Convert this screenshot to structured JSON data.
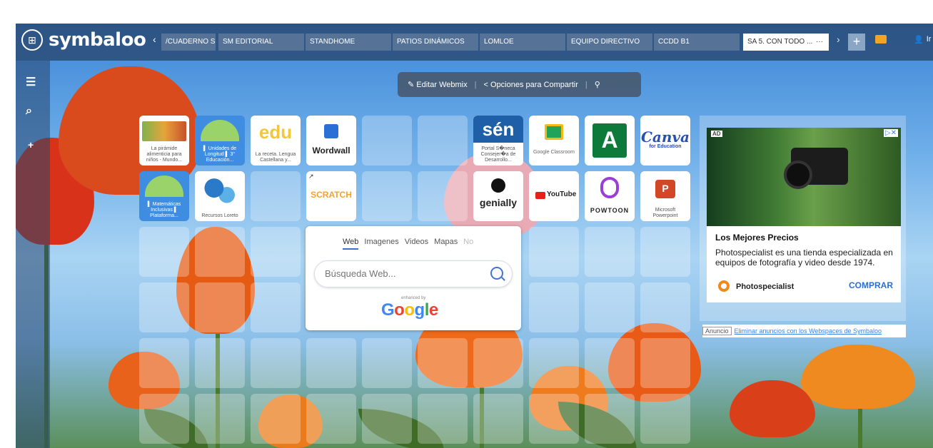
{
  "app": {
    "brand": "symbaloo",
    "apps_glyph": "⊞"
  },
  "tabs": [
    {
      "label": "/CUADERNO S...",
      "active": false
    },
    {
      "label": "SM EDITORIAL",
      "active": false
    },
    {
      "label": "STANDHOME",
      "active": false
    },
    {
      "label": "PATIOS DINÁMICOS",
      "active": false
    },
    {
      "label": "LOMLOE",
      "active": false
    },
    {
      "label": "EQUIPO DIRECTIVO",
      "active": false
    },
    {
      "label": "CCDD B1",
      "active": false
    },
    {
      "label": "SA 5. CON TODO ...",
      "active": true
    }
  ],
  "nav": {
    "prev": "‹",
    "next": "›",
    "add": "+",
    "active_menu": "···",
    "user_initial": "Ir",
    "user_icon": "👤"
  },
  "sidebar": {
    "list_icon": "☰",
    "search_list_icon": "⌕",
    "add_icon": "+"
  },
  "editbar": {
    "edit_label": "Editar Webmix",
    "share_label": "Opciones para Compartir",
    "edit_icon": "✎",
    "share_icon": "<",
    "search_icon": "⚲",
    "sep": "|"
  },
  "tiles": {
    "row1": [
      {
        "caption": "La pirámide alimenticia para niños - Mundo..."
      },
      {
        "caption": "▌ Unidades de Longitud ▌ 3° Educación..."
      },
      {
        "logo": "edu",
        "caption": "La receta. Lengua Castellana y..."
      },
      {
        "logo": "Wordwall"
      },
      {
        "logo": "sén",
        "caption": "Portal S�neca Consejer�a de Desarrollo..."
      },
      {
        "logo": "Google Classroom"
      },
      {
        "logo": "A"
      },
      {
        "logo": "Canva",
        "sub": "for Education"
      }
    ],
    "row2": [
      {
        "caption": "▌ Matemáticas Inclusivas ▌ Plataforma..."
      },
      {
        "caption": "Recursos Loreto"
      },
      {
        "logo": "SCRATCH",
        "corner": "↗"
      },
      {
        "logo": "genially"
      },
      {
        "logo": "YouTube"
      },
      {
        "logo": "POWTOON"
      },
      {
        "logo": "P",
        "caption": "Microsoft Powerpoint"
      }
    ]
  },
  "search": {
    "tabs": [
      "Web",
      "Imagenes",
      "Videos",
      "Mapas",
      "No"
    ],
    "placeholder": "Búsqueda Web...",
    "enhanced": "enhanced by",
    "google_letters": [
      "G",
      "o",
      "o",
      "g",
      "l",
      "e"
    ],
    "google_colors": [
      "#4285F4",
      "#EA4335",
      "#FBBC05",
      "#4285F4",
      "#34A853",
      "#EA4335"
    ]
  },
  "ad": {
    "label": "AD",
    "close": "▷✕",
    "title": "Los Mejores Precios",
    "description": "Photospecialist es una tienda especializada en equipos de fotografía y video desde 1974.",
    "brand": "Photospecialist",
    "cta": "COMPRAR",
    "footer_tag": "Anuncio",
    "footer_link": "Eliminar anuncios con los Webspaces de Symbaloo"
  },
  "colors": {
    "accent": "#3c6fcf",
    "mail": "#f0a428",
    "user": "#4cd36b"
  }
}
